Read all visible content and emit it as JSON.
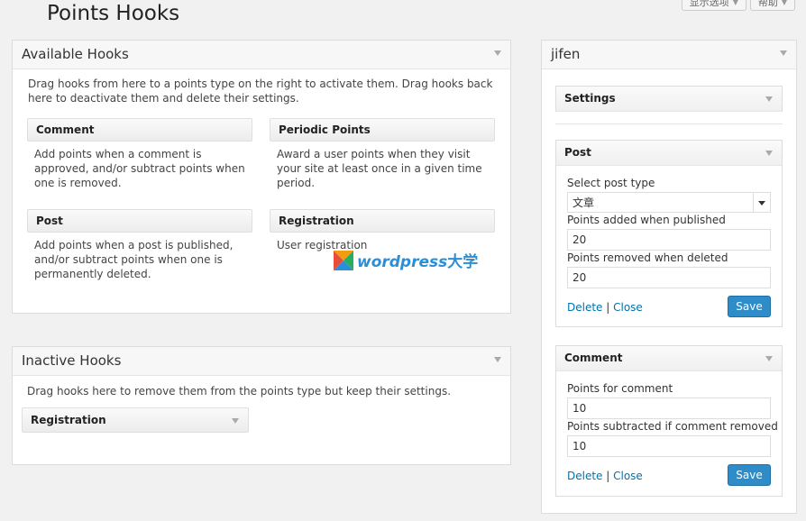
{
  "page_title": "Points Hooks",
  "top_tabs": [
    "显示选项",
    "帮助"
  ],
  "available": {
    "title": "Available Hooks",
    "description": "Drag hooks from here to a points type on the right to activate them. Drag hooks back here to deactivate them and delete their settings.",
    "hooks": [
      {
        "name": "Comment",
        "desc": "Add points when a comment is approved, and/or subtract points when one is removed."
      },
      {
        "name": "Periodic Points",
        "desc": "Award a user points when they visit your site at least once in a given time period."
      },
      {
        "name": "Post",
        "desc": "Add points when a post is published, and/or subtract points when one is permanently deleted."
      },
      {
        "name": "Registration",
        "desc": "User registration"
      }
    ]
  },
  "inactive": {
    "title": "Inactive Hooks",
    "description": "Drag hooks here to remove them from the points type but keep their settings.",
    "hooks": [
      {
        "name": "Registration"
      }
    ]
  },
  "points_type": {
    "title": "jifen",
    "settings_title": "Settings",
    "post": {
      "title": "Post",
      "post_type_label": "Select post type",
      "post_type_value": "文章",
      "added_label": "Points added when published",
      "added_value": "20",
      "removed_label": "Points removed when deleted",
      "removed_value": "20",
      "delete_label": "Delete",
      "close_label": "Close",
      "save_label": "Save"
    },
    "comment": {
      "title": "Comment",
      "points_label": "Points for comment",
      "points_value": "10",
      "subtracted_label": "Points subtracted if comment removed",
      "subtracted_value": "10",
      "delete_label": "Delete",
      "close_label": "Close",
      "save_label": "Save"
    }
  },
  "watermark": {
    "text": "wordpress",
    "cn": "大学"
  },
  "colors": {
    "accent": "#2e8cc8",
    "link": "#0073aa"
  }
}
